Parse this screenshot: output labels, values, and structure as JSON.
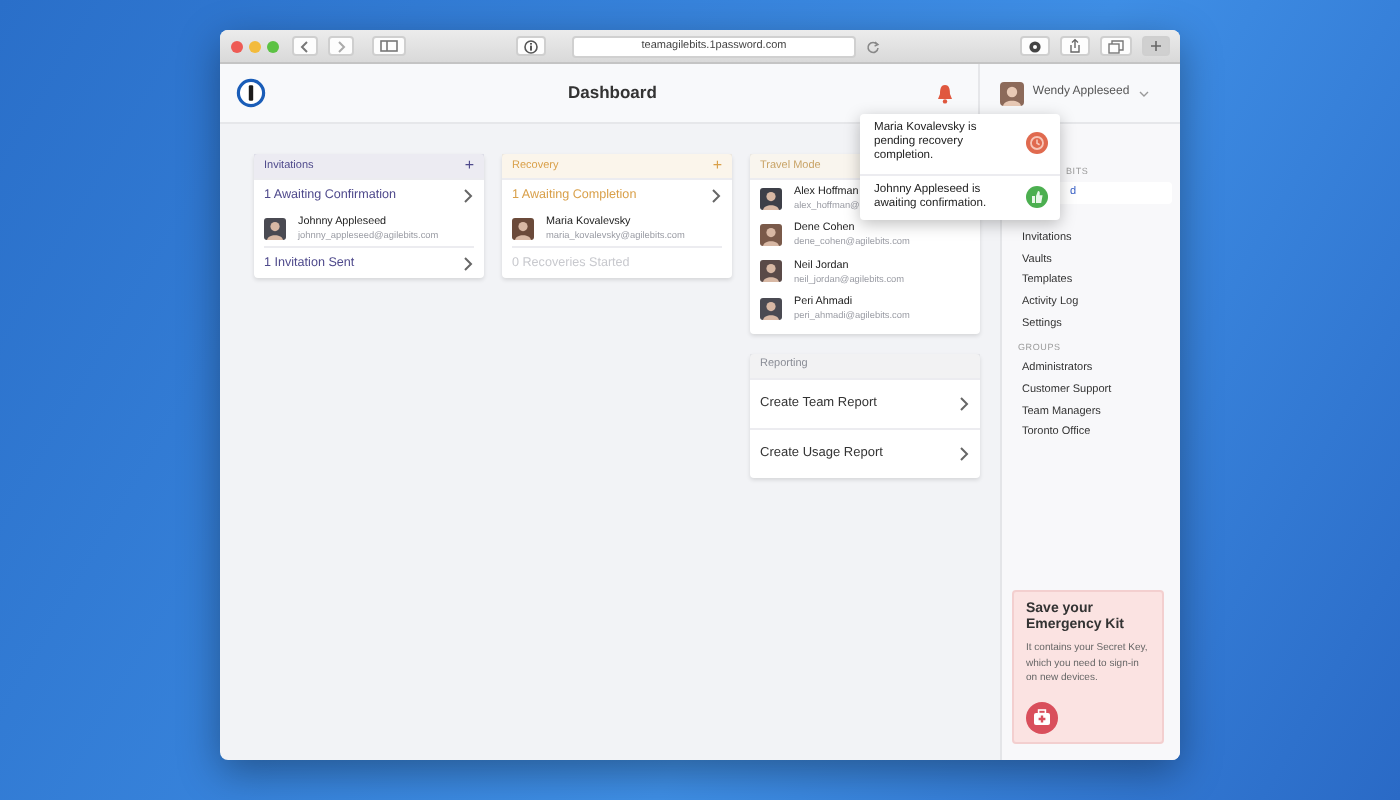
{
  "browser": {
    "url": "teamagilebits.1password.com"
  },
  "header": {
    "title": "Dashboard",
    "user": "Wendy Appleseed"
  },
  "cards": [
    {
      "title": "Invitations",
      "add": "+",
      "color": "#4f4a8c",
      "rows": [
        {
          "kind": "link",
          "label": "1 Awaiting Confirmation",
          "disabled": false
        },
        {
          "kind": "person",
          "name": "Johnny Appleseed",
          "email": "johnny_appleseed@agilebits.com"
        },
        {
          "kind": "link",
          "label": "1 Invitation Sent",
          "disabled": false
        }
      ]
    },
    {
      "title": "Recovery",
      "add": "+",
      "color": "#d9a04a",
      "rows": [
        {
          "kind": "link",
          "label": "1 Awaiting Completion",
          "disabled": false
        },
        {
          "kind": "person",
          "name": "Maria Kovalevsky",
          "email": "maria_kovalevsky@agilebits.com"
        },
        {
          "kind": "link",
          "label": "0 Recoveries Started",
          "disabled": true
        }
      ]
    },
    {
      "title": "Travel Mode",
      "color": "#c9a468",
      "rows": [
        {
          "kind": "person",
          "name": "Alex Hoffman",
          "email": "alex_hoffman@"
        },
        {
          "kind": "person",
          "name": "Dene Cohen",
          "email": "dene_cohen@agilebits.com"
        },
        {
          "kind": "person",
          "name": "Neil Jordan",
          "email": "neil_jordan@agilebits.com"
        },
        {
          "kind": "person",
          "name": "Peri Ahmadi",
          "email": "peri_ahmadi@agilebits.com"
        }
      ]
    },
    {
      "title": "Reporting",
      "color": "#8a8d96",
      "rows": [
        {
          "kind": "link",
          "label": "Create Team Report",
          "disabled": false
        },
        {
          "kind": "link",
          "label": "Create Usage Report",
          "disabled": false
        }
      ]
    }
  ],
  "notifications": [
    {
      "kind": "recovery",
      "text": "Maria Kovalevsky is pending recovery completion."
    },
    {
      "kind": "invite",
      "text": "Johnny Appleseed is awaiting confirmation."
    }
  ],
  "sidebar": [
    {
      "heading": "BITS",
      "items": [
        {
          "label": "d",
          "selected": true
        },
        {
          "label": "Invitations",
          "selected": false
        },
        {
          "label": "Vaults",
          "selected": false
        },
        {
          "label": "Templates",
          "selected": false
        },
        {
          "label": "Activity Log",
          "selected": false
        },
        {
          "label": "Settings",
          "selected": false
        }
      ]
    },
    {
      "heading": "GROUPS",
      "items": [
        {
          "label": "Administrators",
          "selected": false
        },
        {
          "label": "Customer Support",
          "selected": false
        },
        {
          "label": "Team Managers",
          "selected": false
        },
        {
          "label": "Toronto Office",
          "selected": false
        }
      ]
    }
  ],
  "emergency_kit": {
    "title": "Save your Emergency Kit",
    "text": "It contains your Secret Key, which you need to sign-in on new devices."
  }
}
